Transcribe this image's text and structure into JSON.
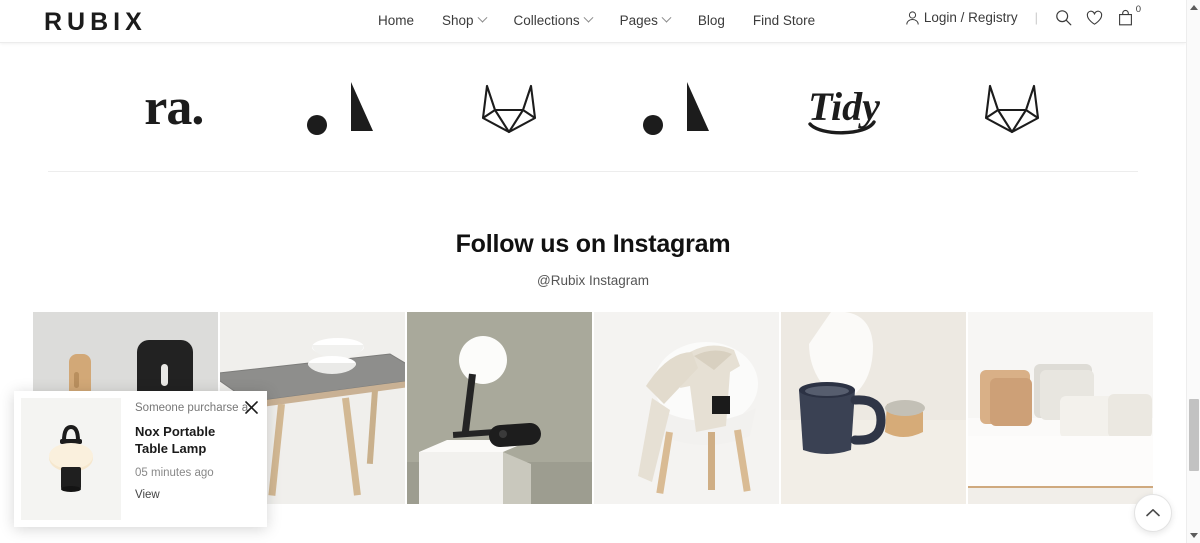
{
  "header": {
    "brand": "RUBIX",
    "nav": [
      {
        "label": "Home",
        "has_dropdown": false
      },
      {
        "label": "Shop",
        "has_dropdown": true
      },
      {
        "label": "Collections",
        "has_dropdown": true
      },
      {
        "label": "Pages",
        "has_dropdown": true
      },
      {
        "label": "Blog",
        "has_dropdown": false
      },
      {
        "label": "Find Store",
        "has_dropdown": false
      }
    ],
    "login_label": "Login / Registry",
    "separator": "|",
    "icons": [
      "user-icon",
      "search-icon",
      "heart-icon",
      "shopping-bag-icon"
    ],
    "cart_count": "0"
  },
  "brand_logos": [
    {
      "name": "ra-logo",
      "text": "ra."
    },
    {
      "name": "dot-triangle-logo",
      "text": ""
    },
    {
      "name": "fox-head-logo",
      "text": ""
    },
    {
      "name": "dot-triangle-logo-2",
      "text": ""
    },
    {
      "name": "tidy-script-logo",
      "text": "Tidy"
    },
    {
      "name": "fox-head-logo-2",
      "text": ""
    }
  ],
  "instagram": {
    "title": "Follow us on Instagram",
    "subtitle": "@Rubix Instagram",
    "tiles": [
      {
        "alt": "wooden-and-black-chairs"
      },
      {
        "alt": "grey-top-table-with-bowls"
      },
      {
        "alt": "globe-table-lamp-on-marble-plinth"
      },
      {
        "alt": "linen-jacket-on-white-shell-chair"
      },
      {
        "alt": "navy-ceramic-pitcher-and-vase"
      },
      {
        "alt": "white-sofa-with-cushions"
      }
    ]
  },
  "popup": {
    "pre_text": "Someone purcharse a",
    "product_name": "Nox Portable Table Lamp",
    "time_ago": "05 minutes ago",
    "view_label": "View",
    "close_icon": "close-icon",
    "thumb_alt": "nox-portable-table-lamp"
  },
  "scroll_top": {
    "icon": "chevron-up-icon"
  },
  "colors": {
    "text_dark": "#1b1b1b",
    "text_muted": "#777777",
    "border": "#ededed",
    "page_bg": "#ffffff"
  }
}
